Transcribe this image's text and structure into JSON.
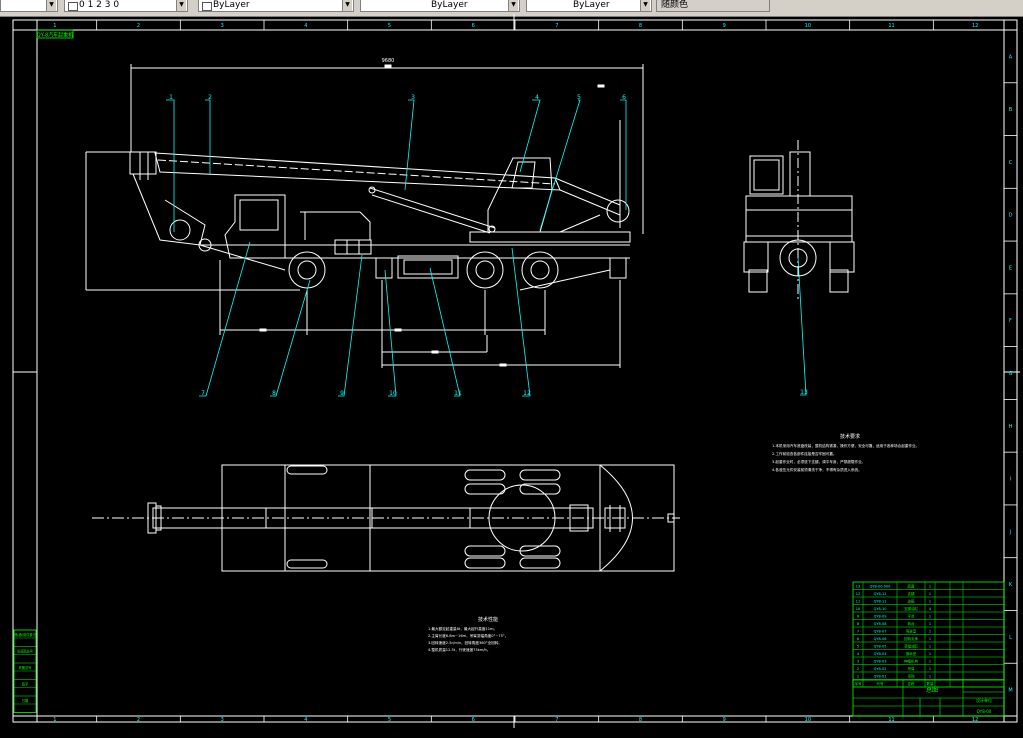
{
  "toolbar": {
    "layer_combo": "0 1 2 3 0",
    "color_combo": "ByLayer",
    "linetype_combo": "ByLayer",
    "lineweight_combo": "ByLayer",
    "plotstyle_button": "随颜色"
  },
  "drawing": {
    "title_box": "QY-8汽车起重机",
    "col_numbers": [
      "1",
      "2",
      "3",
      "4",
      "5",
      "6",
      "7",
      "8",
      "9",
      "10",
      "11",
      "12"
    ],
    "row_letters": [
      "A",
      "B",
      "C",
      "D",
      "E",
      "F",
      "G",
      "H",
      "I",
      "J",
      "K",
      "L",
      "M"
    ],
    "callouts_top": [
      "1",
      "2",
      "3",
      "4",
      "5",
      "6"
    ],
    "callouts_bottom": [
      "7",
      "8",
      "9",
      "10",
      "11",
      "12"
    ],
    "callout_side": "13",
    "dimension_top": "9680",
    "tech_req_title_1": "技术要求",
    "tech_req_lines_1": [
      "1.本机采用汽车底盘改装，整机结构紧凑，操作方便，安全可靠，适用于各种场合起重作业。",
      "2.工作前检查各部件连接是否牢固可靠。",
      "3.起重作业时，必须放下支腿，调平车身，严禁超载作业。",
      "4.各液压元件安装前须清洗干净，不得有杂质进入系统。"
    ],
    "tech_req_title_2": "技术性能",
    "tech_req_lines_2": [
      "1.最大额定起重量8t，最大起升高度11m。",
      "2.主臂长度6.8m~16m，吊臂变幅角度0°~75°。",
      "3.回转速度2.5r/min，回转角度360°全回转。",
      "4.整机质量12.5t，行驶速度75km/h。"
    ],
    "bom_rows": [
      [
        "13",
        "QY8-00-000",
        "底盘",
        "1"
      ],
      [
        "12",
        "QY8-12",
        "支腿",
        "1"
      ],
      [
        "11",
        "QY8-11",
        "油箱",
        "1"
      ],
      [
        "10",
        "QY8-10",
        "支腿油缸",
        "4"
      ],
      [
        "9",
        "QY8-09",
        "平台",
        "1"
      ],
      [
        "8",
        "QY8-08",
        "转台",
        "1"
      ],
      [
        "7",
        "QY8-07",
        "驾驶室",
        "1"
      ],
      [
        "6",
        "QY8-06",
        "回转支承",
        "1"
      ],
      [
        "5",
        "QY8-05",
        "变幅油缸",
        "1"
      ],
      [
        "4",
        "QY8-04",
        "操纵室",
        "1"
      ],
      [
        "3",
        "QY8-03",
        "伸缩机构",
        "1"
      ],
      [
        "2",
        "QY8-02",
        "吊臂",
        "1"
      ],
      [
        "1",
        "QY8-01",
        "吊钩",
        "1"
      ]
    ],
    "bom_header": [
      "序号",
      "代号",
      "名称",
      "数量"
    ],
    "title_block_name": "总图",
    "title_block_drawing_no": "QY8-00",
    "title_block_company": "设计单位",
    "left_strip": [
      "借(通)用件登记",
      "旧底图总号",
      "底图总号",
      "签字",
      "日期"
    ]
  },
  "colors": {
    "background": "#000000",
    "lines": "#ffffff",
    "cyan": "#00ffff",
    "green": "#00ff00",
    "yellow": "#ffff00"
  }
}
